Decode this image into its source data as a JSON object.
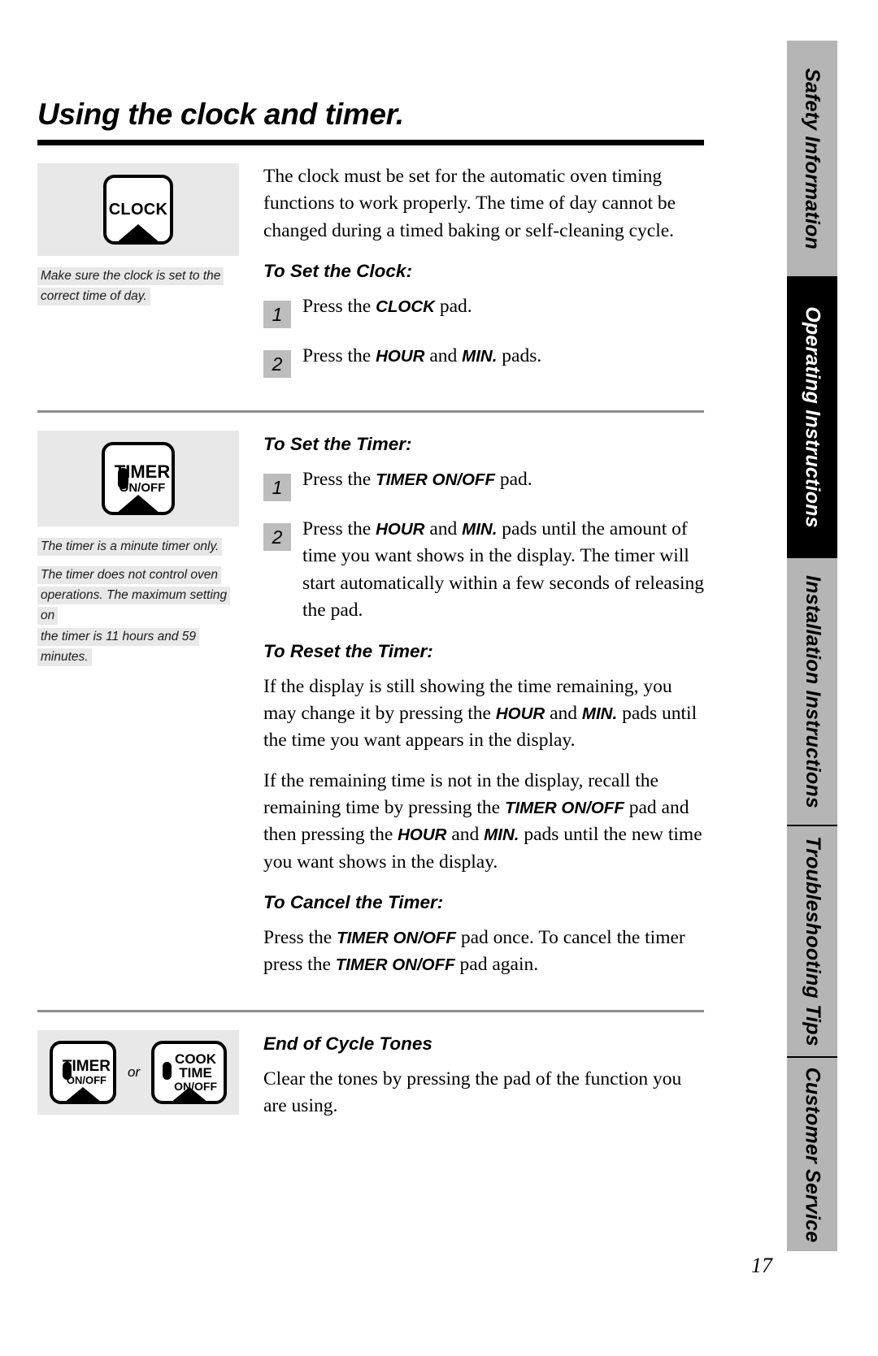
{
  "page": {
    "title": "Using the clock and timer.",
    "number": "17"
  },
  "sidebar": {
    "tabs": [
      {
        "label": "Safety Information",
        "active": false
      },
      {
        "label": "Operating Instructions",
        "active": true
      },
      {
        "label": "Installation Instructions",
        "active": false
      },
      {
        "label": "Troubleshooting Tips",
        "active": false
      },
      {
        "label": "Customer Service",
        "active": false
      }
    ]
  },
  "clock_section": {
    "pad_label": "CLOCK",
    "note": [
      "Make sure the clock is set to the",
      "correct time of day."
    ],
    "intro": "The clock must be set for the automatic oven timing functions to work properly. The time of day cannot be changed during a timed baking or self-cleaning cycle.",
    "heading": "To Set the Clock:",
    "steps": [
      {
        "number": "1",
        "pre": "Press the ",
        "pad": "CLOCK",
        "post": " pad."
      },
      {
        "number": "2",
        "pre": "Press the ",
        "pad": "HOUR",
        "mid": " and ",
        "pad2": "MIN.",
        "post": " pads."
      }
    ]
  },
  "timer_section": {
    "pad_line1": "TIMER",
    "pad_line2": "ON/OFF",
    "note": [
      "The timer is a minute timer only.",
      "The timer does not control oven",
      "operations. The maximum setting on",
      "the timer is 11 hours and 59 minutes."
    ],
    "set_heading": "To Set the Timer:",
    "set_steps": [
      {
        "number": "1",
        "pre": "Press the ",
        "pad": "TIMER ON/OFF",
        "post": " pad."
      },
      {
        "number": "2",
        "pre": "Press the ",
        "pad": "HOUR",
        "mid": " and ",
        "pad2": "MIN.",
        "post": " pads until the amount of time you want shows in the display. The timer will start automatically within a few seconds of releasing the pad."
      }
    ],
    "reset_heading": "To Reset the Timer:",
    "reset_p1_a": "If the display is still showing the time remaining, you may change it by pressing the ",
    "reset_p1_pad1": "HOUR",
    "reset_p1_b": " and ",
    "reset_p1_pad2": "MIN.",
    "reset_p1_c": " pads until the time you want appears in the display.",
    "reset_p2_a": "If the remaining time is not in the display, recall the remaining time by pressing the ",
    "reset_p2_pad1": "TIMER ON/OFF",
    "reset_p2_b": " pad and then pressing the ",
    "reset_p2_pad2": "HOUR",
    "reset_p2_c": " and ",
    "reset_p2_pad3": "MIN.",
    "reset_p2_d": " pads until the new time you want shows in the display.",
    "cancel_heading": "To Cancel the Timer:",
    "cancel_a": "Press the ",
    "cancel_pad1": "TIMER ON/OFF",
    "cancel_b": " pad once. To cancel the timer press the ",
    "cancel_pad2": "TIMER ON/OFF",
    "cancel_c": " pad again."
  },
  "tones_section": {
    "pad_timer_line1": "TIMER",
    "pad_timer_line2": "ON/OFF",
    "or_label": "or",
    "pad_cook_line1": "COOK",
    "pad_cook_line2": "TIME",
    "pad_cook_line3": "ON/OFF",
    "heading": "End of Cycle Tones",
    "body": "Clear the tones by pressing the pad of the function you are using."
  },
  "colors": {
    "panel_gray": "#e8e8e8",
    "tab_gray": "#b5b5b5",
    "tab_active": "#000000",
    "step_num_gray": "#bdbdbd",
    "rule_gray": "#8c8c8c"
  }
}
